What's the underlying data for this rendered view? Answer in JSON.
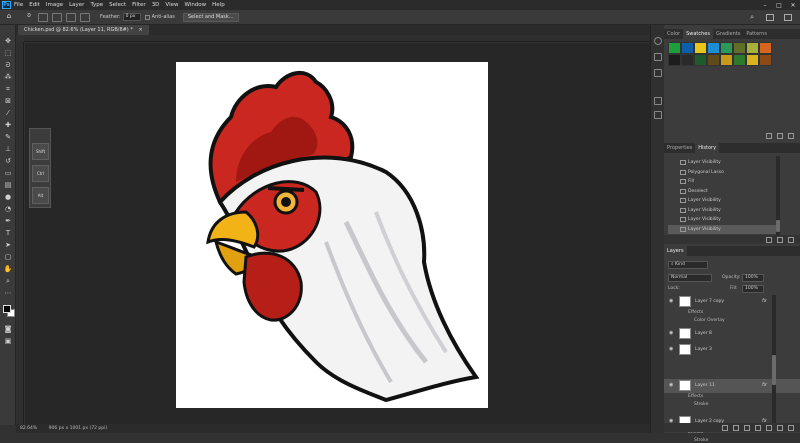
{
  "menubar": {
    "logo": "Ps",
    "items": [
      "File",
      "Edit",
      "Image",
      "Layer",
      "Type",
      "Select",
      "Filter",
      "3D",
      "View",
      "Window",
      "Help"
    ],
    "window_controls": [
      "–",
      "□",
      "✕"
    ]
  },
  "options": {
    "feather_label": "Feather:",
    "feather_value": "0 px",
    "antialias_label": "Anti-alias",
    "select_mask_label": "Select and Mask..."
  },
  "document": {
    "tab_title": "Chicken.psd @ 82.6% (Layer 11, RGB/8#) *",
    "status_zoom": "82.64%",
    "status_info": "906 px x 1001 px (72 ppi)"
  },
  "float_panel": {
    "buttons": [
      "Shift",
      "Ctrl",
      "Alt"
    ]
  },
  "color_panel": {
    "tabs": [
      "Color",
      "Swatches",
      "Gradients",
      "Patterns"
    ],
    "active_tab": "Swatches",
    "swatches": [
      "#1f9e3c",
      "#0d5fa8",
      "#e8c51a",
      "#1a8fd6",
      "#2c9a56",
      "#5f6f2a",
      "#a9b03a",
      "#d8641d",
      "#1d1d1d",
      "#2a2a2a",
      "#1e5a2a",
      "#5f4a1c",
      "#c89a1a",
      "#2d7a2d",
      "#d9b21e",
      "#8c4a14"
    ]
  },
  "history_panel": {
    "tabs": [
      "Properties",
      "History"
    ],
    "active_tab": "History",
    "items": [
      "Layer Visibility",
      "Polygonal Lasso",
      "Fill",
      "Deselect",
      "Layer Visibility",
      "Layer Visibility",
      "Layer Visibility",
      "Layer Visibility"
    ],
    "selected_index": 7
  },
  "layers_panel": {
    "title": "Layers",
    "filter_kind": "Kind",
    "blend_mode": "Normal",
    "opacity_label": "Opacity:",
    "opacity_value": "100%",
    "lock_label": "Lock:",
    "fill_label": "Fill:",
    "fill_value": "100%",
    "rows": [
      {
        "name": "Layer 7 copy",
        "fx": "fx",
        "sub": [
          "Effects",
          "Color Overlay"
        ]
      },
      {
        "name": "Layer 8",
        "fx": ""
      },
      {
        "name": "Layer 3",
        "fx": ""
      },
      {
        "name": "Layer 11",
        "fx": "fx",
        "sub": [
          "Effects",
          "Stroke"
        ]
      },
      {
        "name": "Layer 2 copy",
        "fx": "fx",
        "sub": [
          "Effects",
          "Stroke"
        ]
      }
    ]
  }
}
